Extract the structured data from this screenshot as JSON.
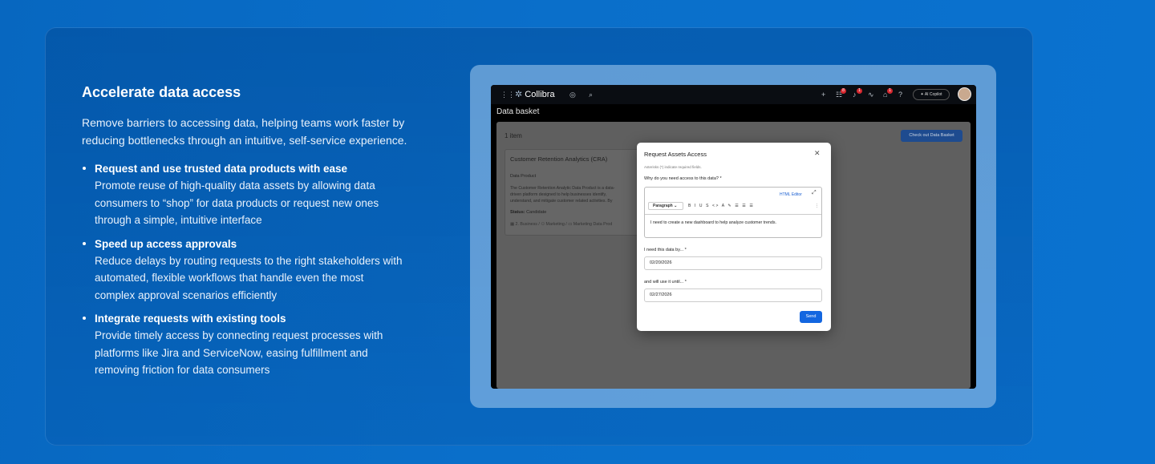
{
  "section": {
    "title": "Accelerate data access",
    "intro": "Remove barriers to accessing data, helping teams work faster by reducing bottlenecks through an intuitive, self-service experience.",
    "bullets": [
      {
        "title": "Request and use trusted data products with ease",
        "lines": [
          "Promote reuse of high-quality data assets by allowing data",
          "consumers to “shop” for data products or request new ones",
          "through a simple, intuitive interface"
        ]
      },
      {
        "title": "Speed up access approvals",
        "lines": [
          "Reduce delays by routing requests to the right stakeholders with",
          "automated, flexible workflows that handle even the most",
          "complex approval scenarios efficiently"
        ]
      },
      {
        "title": "Integrate requests with existing tools",
        "lines": [
          "Provide timely access by connecting request processes with",
          "platforms like Jira and ServiceNow, easing fulfillment and",
          "removing friction for data consumers"
        ]
      }
    ]
  },
  "app": {
    "brand": "Collibra",
    "copilot_label": "AI Copilot",
    "badges": [
      "8",
      "1",
      "1"
    ],
    "page_title": "Data basket",
    "item_count": "1 item",
    "checkout_label": "Check out Data Basket",
    "item": {
      "name": "Customer Retention Analytics (CRA)",
      "type": "Data Product",
      "desc_lines": [
        "The Customer Retention Analytic Data Product is a data-",
        "driven platform designed to help businesses identify,",
        "understand, and mitigate customer related activities. By"
      ],
      "status_label": "Status:",
      "status_value": "Candidate",
      "breadcrumb": [
        "2. Business",
        "Marketing",
        "Marketing Data Prod"
      ]
    }
  },
  "modal": {
    "title": "Request Assets Access",
    "note": "Asterisks (*) indicate required fields.",
    "reason_label": "Why do you need access to this data? *",
    "html_editor": "HTML Editor",
    "paragraph": "Paragraph",
    "tools": "B I U S <> A ✎ ☰ ☰ ☰",
    "reason_text": "I need to create a new dashboard to help analyze customer trends.",
    "need_by_label": "I need this data by... *",
    "need_by_value": "02/20/2026",
    "use_until_label": "and will use it until... *",
    "use_until_value": "02/27/2026",
    "send_label": "Send"
  }
}
